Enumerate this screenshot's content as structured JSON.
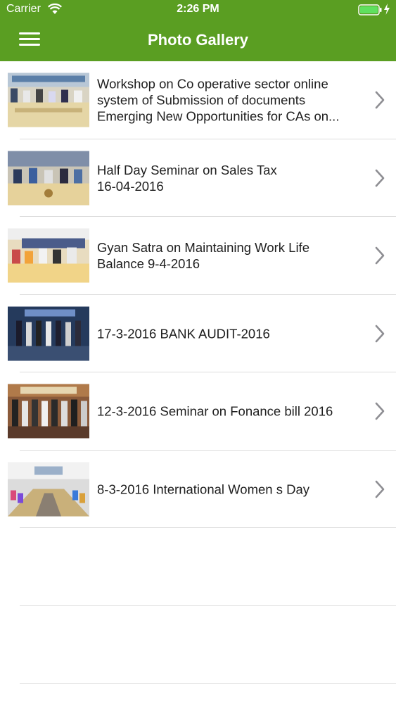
{
  "status_bar": {
    "carrier": "Carrier",
    "time": "2:26 PM"
  },
  "header": {
    "title": "Photo Gallery",
    "menu_icon": "hamburger-menu-icon",
    "background_color": "#5a9e22"
  },
  "gallery": [
    {
      "title": "Workshop on Co operative sector online\nsystem of Submission of documents\nEmerging New Opportunities for CAs on..."
    },
    {
      "title": "Half Day Seminar on Sales Tax\n16-04-2016"
    },
    {
      "title": "Gyan Satra on Maintaining Work Life\nBalance 9-4-2016"
    },
    {
      "title": "17-3-2016 BANK AUDIT-2016"
    },
    {
      "title": "12-3-2016 Seminar on Fonance bill 2016"
    },
    {
      "title": "8-3-2016 International Women s Day"
    }
  ]
}
